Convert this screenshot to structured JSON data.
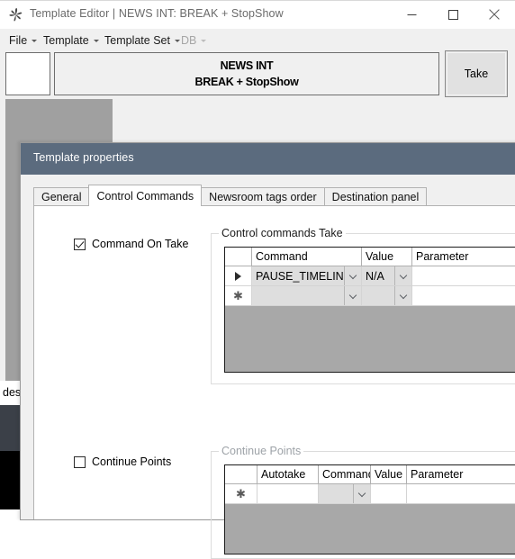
{
  "window": {
    "title": "Template Editor | NEWS INT: BREAK + StopShow",
    "icon": "pinwheel-app-icon",
    "controls": {
      "minimize": "—",
      "maximize": "□",
      "close": "✕"
    }
  },
  "menubar": {
    "items": [
      {
        "label": "File",
        "disabled": false
      },
      {
        "label": "Template",
        "disabled": false
      },
      {
        "label": "Template Set",
        "disabled": false
      },
      {
        "label": "DB",
        "disabled": true
      }
    ]
  },
  "toolbar": {
    "banner_line1": "NEWS INT",
    "banner_line2": "BREAK + StopShow",
    "take_label": "Take"
  },
  "background": {
    "desc_text": "desc"
  },
  "dialog": {
    "title": "Template properties",
    "tabs": [
      {
        "label": "General",
        "active": false
      },
      {
        "label": "Control Commands",
        "active": true
      },
      {
        "label": "Newsroom tags order",
        "active": false
      },
      {
        "label": "Destination panel",
        "active": false
      }
    ],
    "command_on_take": {
      "label": "Command On Take",
      "checked": true
    },
    "continue_points": {
      "label": "Continue Points",
      "checked": false
    },
    "take_group": {
      "legend": "Control commands Take",
      "columns": [
        "",
        "Command",
        "Value",
        "Parameter"
      ],
      "rows": [
        {
          "indicator": "current-row-arrow",
          "command": "PAUSE_TIMELINE",
          "value": "N/A",
          "parameter": ""
        },
        {
          "indicator": "new-row-star",
          "command": "",
          "value": "",
          "parameter": ""
        }
      ]
    },
    "continue_group": {
      "legend": "Continue Points",
      "columns": [
        "",
        "Autotake",
        "Command",
        "Value",
        "Parameter"
      ],
      "rows": [
        {
          "indicator": "new-row-star",
          "autotake": "",
          "command": "",
          "value": "",
          "parameter": ""
        }
      ]
    }
  },
  "colors": {
    "dialog_header": "#5b6b7e",
    "window_chrome": "#f0f0f0",
    "grid_empty": "#a8a8a8",
    "combo_fill": "#dedede",
    "backdrop_gray": "#a0a0a0",
    "backdrop_slate": "#3b4048",
    "backdrop_black": "#000000"
  }
}
